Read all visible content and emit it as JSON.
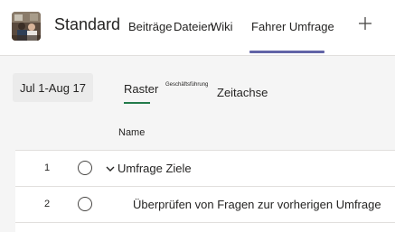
{
  "header": {
    "channel_title": "Standard",
    "tabs": [
      {
        "label": "Beiträge"
      },
      {
        "label": "Dateien"
      },
      {
        "label": "Wiki"
      },
      {
        "label": "Fahrer Umfrage",
        "active": true
      }
    ],
    "accent_color": "#6264a7"
  },
  "toolbar": {
    "date_range": "Jul 1-Aug 17",
    "views": [
      {
        "label": "Raster",
        "active": true
      },
      {
        "label": "Geschäftsführung"
      },
      {
        "label": "Zeitachse"
      }
    ],
    "active_view_color": "#237b4b"
  },
  "table": {
    "column_header": "Name",
    "rows": [
      {
        "number": "1",
        "name": "Umfrage Ziele",
        "expandable": true
      },
      {
        "number": "2",
        "name": "Überprüfen von Fragen zur vorherigen Umfrage",
        "expandable": false
      }
    ]
  }
}
